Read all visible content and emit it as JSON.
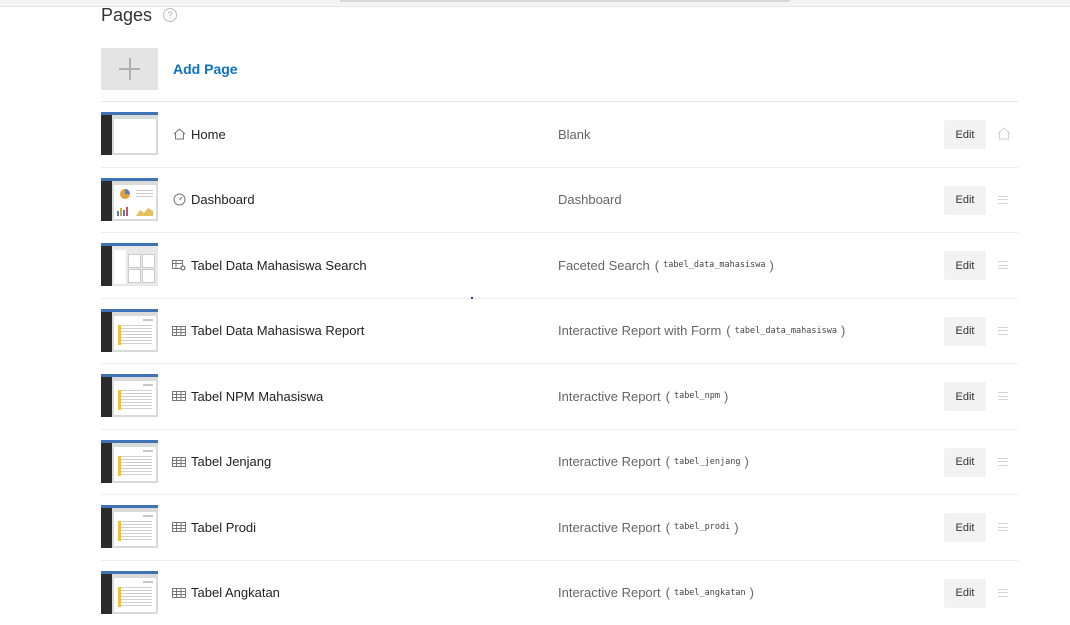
{
  "header": {
    "title": "Pages",
    "help_icon": "question-circle-icon"
  },
  "add_page": {
    "label": "Add Page",
    "icon": "plus-icon"
  },
  "pages": [
    {
      "name": "Home",
      "icon": "home-icon",
      "type": "Blank",
      "source": "",
      "edit": "Edit",
      "right_icon": "home-icon"
    },
    {
      "name": "Dashboard",
      "icon": "gauge-icon",
      "type": "Dashboard",
      "source": "",
      "edit": "Edit",
      "right_icon": "drag-handle-icon"
    },
    {
      "name": "Tabel Data Mahasiswa Search",
      "icon": "faceted-search-icon",
      "type": "Faceted Search",
      "source": "tabel_data_mahasiswa",
      "edit": "Edit",
      "right_icon": "drag-handle-icon"
    },
    {
      "name": "Tabel Data Mahasiswa Report",
      "icon": "table-icon",
      "type": "Interactive Report with Form",
      "source": "tabel_data_mahasiswa",
      "edit": "Edit",
      "right_icon": "drag-handle-icon"
    },
    {
      "name": "Tabel NPM Mahasiswa",
      "icon": "table-icon",
      "type": "Interactive Report",
      "source": "tabel_npm",
      "edit": "Edit",
      "right_icon": "drag-handle-icon"
    },
    {
      "name": "Tabel Jenjang",
      "icon": "table-icon",
      "type": "Interactive Report",
      "source": "tabel_jenjang",
      "edit": "Edit",
      "right_icon": "drag-handle-icon"
    },
    {
      "name": "Tabel Prodi",
      "icon": "table-icon",
      "type": "Interactive Report",
      "source": "tabel_prodi",
      "edit": "Edit",
      "right_icon": "drag-handle-icon"
    },
    {
      "name": "Tabel Angkatan",
      "icon": "table-icon",
      "type": "Interactive Report",
      "source": "tabel_angkatan",
      "edit": "Edit",
      "right_icon": "drag-handle-icon"
    }
  ],
  "colors": {
    "link": "#0a72c3",
    "thumb_header": "#3f73b5",
    "thumb_sidebar": "#2b2b2b"
  }
}
